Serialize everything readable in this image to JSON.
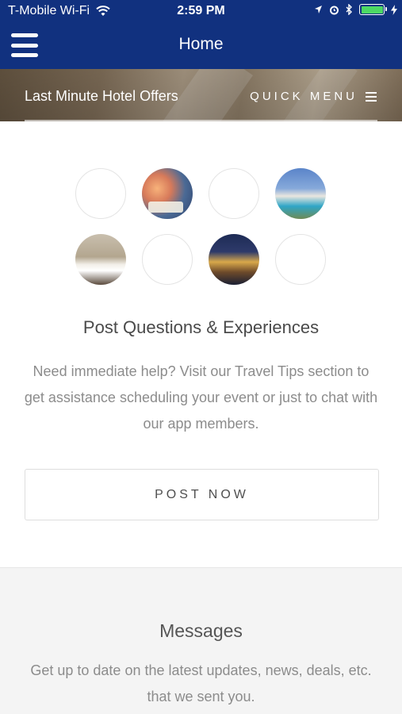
{
  "status_bar": {
    "carrier": "T-Mobile Wi-Fi",
    "time": "2:59 PM",
    "battery_level": 1.0,
    "icons": [
      "wifi-icon",
      "location-icon",
      "alarm-icon",
      "bluetooth-icon",
      "battery-icon",
      "charging-icon"
    ]
  },
  "header": {
    "title": "Home",
    "menu_icon": "hamburger-menu-icon"
  },
  "banner": {
    "offers_label": "Last Minute Hotel Offers",
    "quick_menu_label": "QUICK MENU",
    "quick_menu_icon": "menu-lines-icon"
  },
  "gallery": {
    "items": [
      "blank",
      "santorini-sunset",
      "blank",
      "resort-pool",
      "hotel-bedroom",
      "blank",
      "night-hotel",
      "blank"
    ]
  },
  "post_section": {
    "title": "Post Questions & Experiences",
    "body": "Need immediate help? Visit our Travel Tips section to get assistance scheduling your event or just to chat with our app members.",
    "button_label": "POST NOW"
  },
  "messages_section": {
    "title": "Messages",
    "body": "Get up to date on the latest updates, news, deals, etc. that we sent you."
  },
  "colors": {
    "header_bg": "#11317f",
    "battery_fill": "#4cd964",
    "text_gray": "#8c8c8c"
  }
}
